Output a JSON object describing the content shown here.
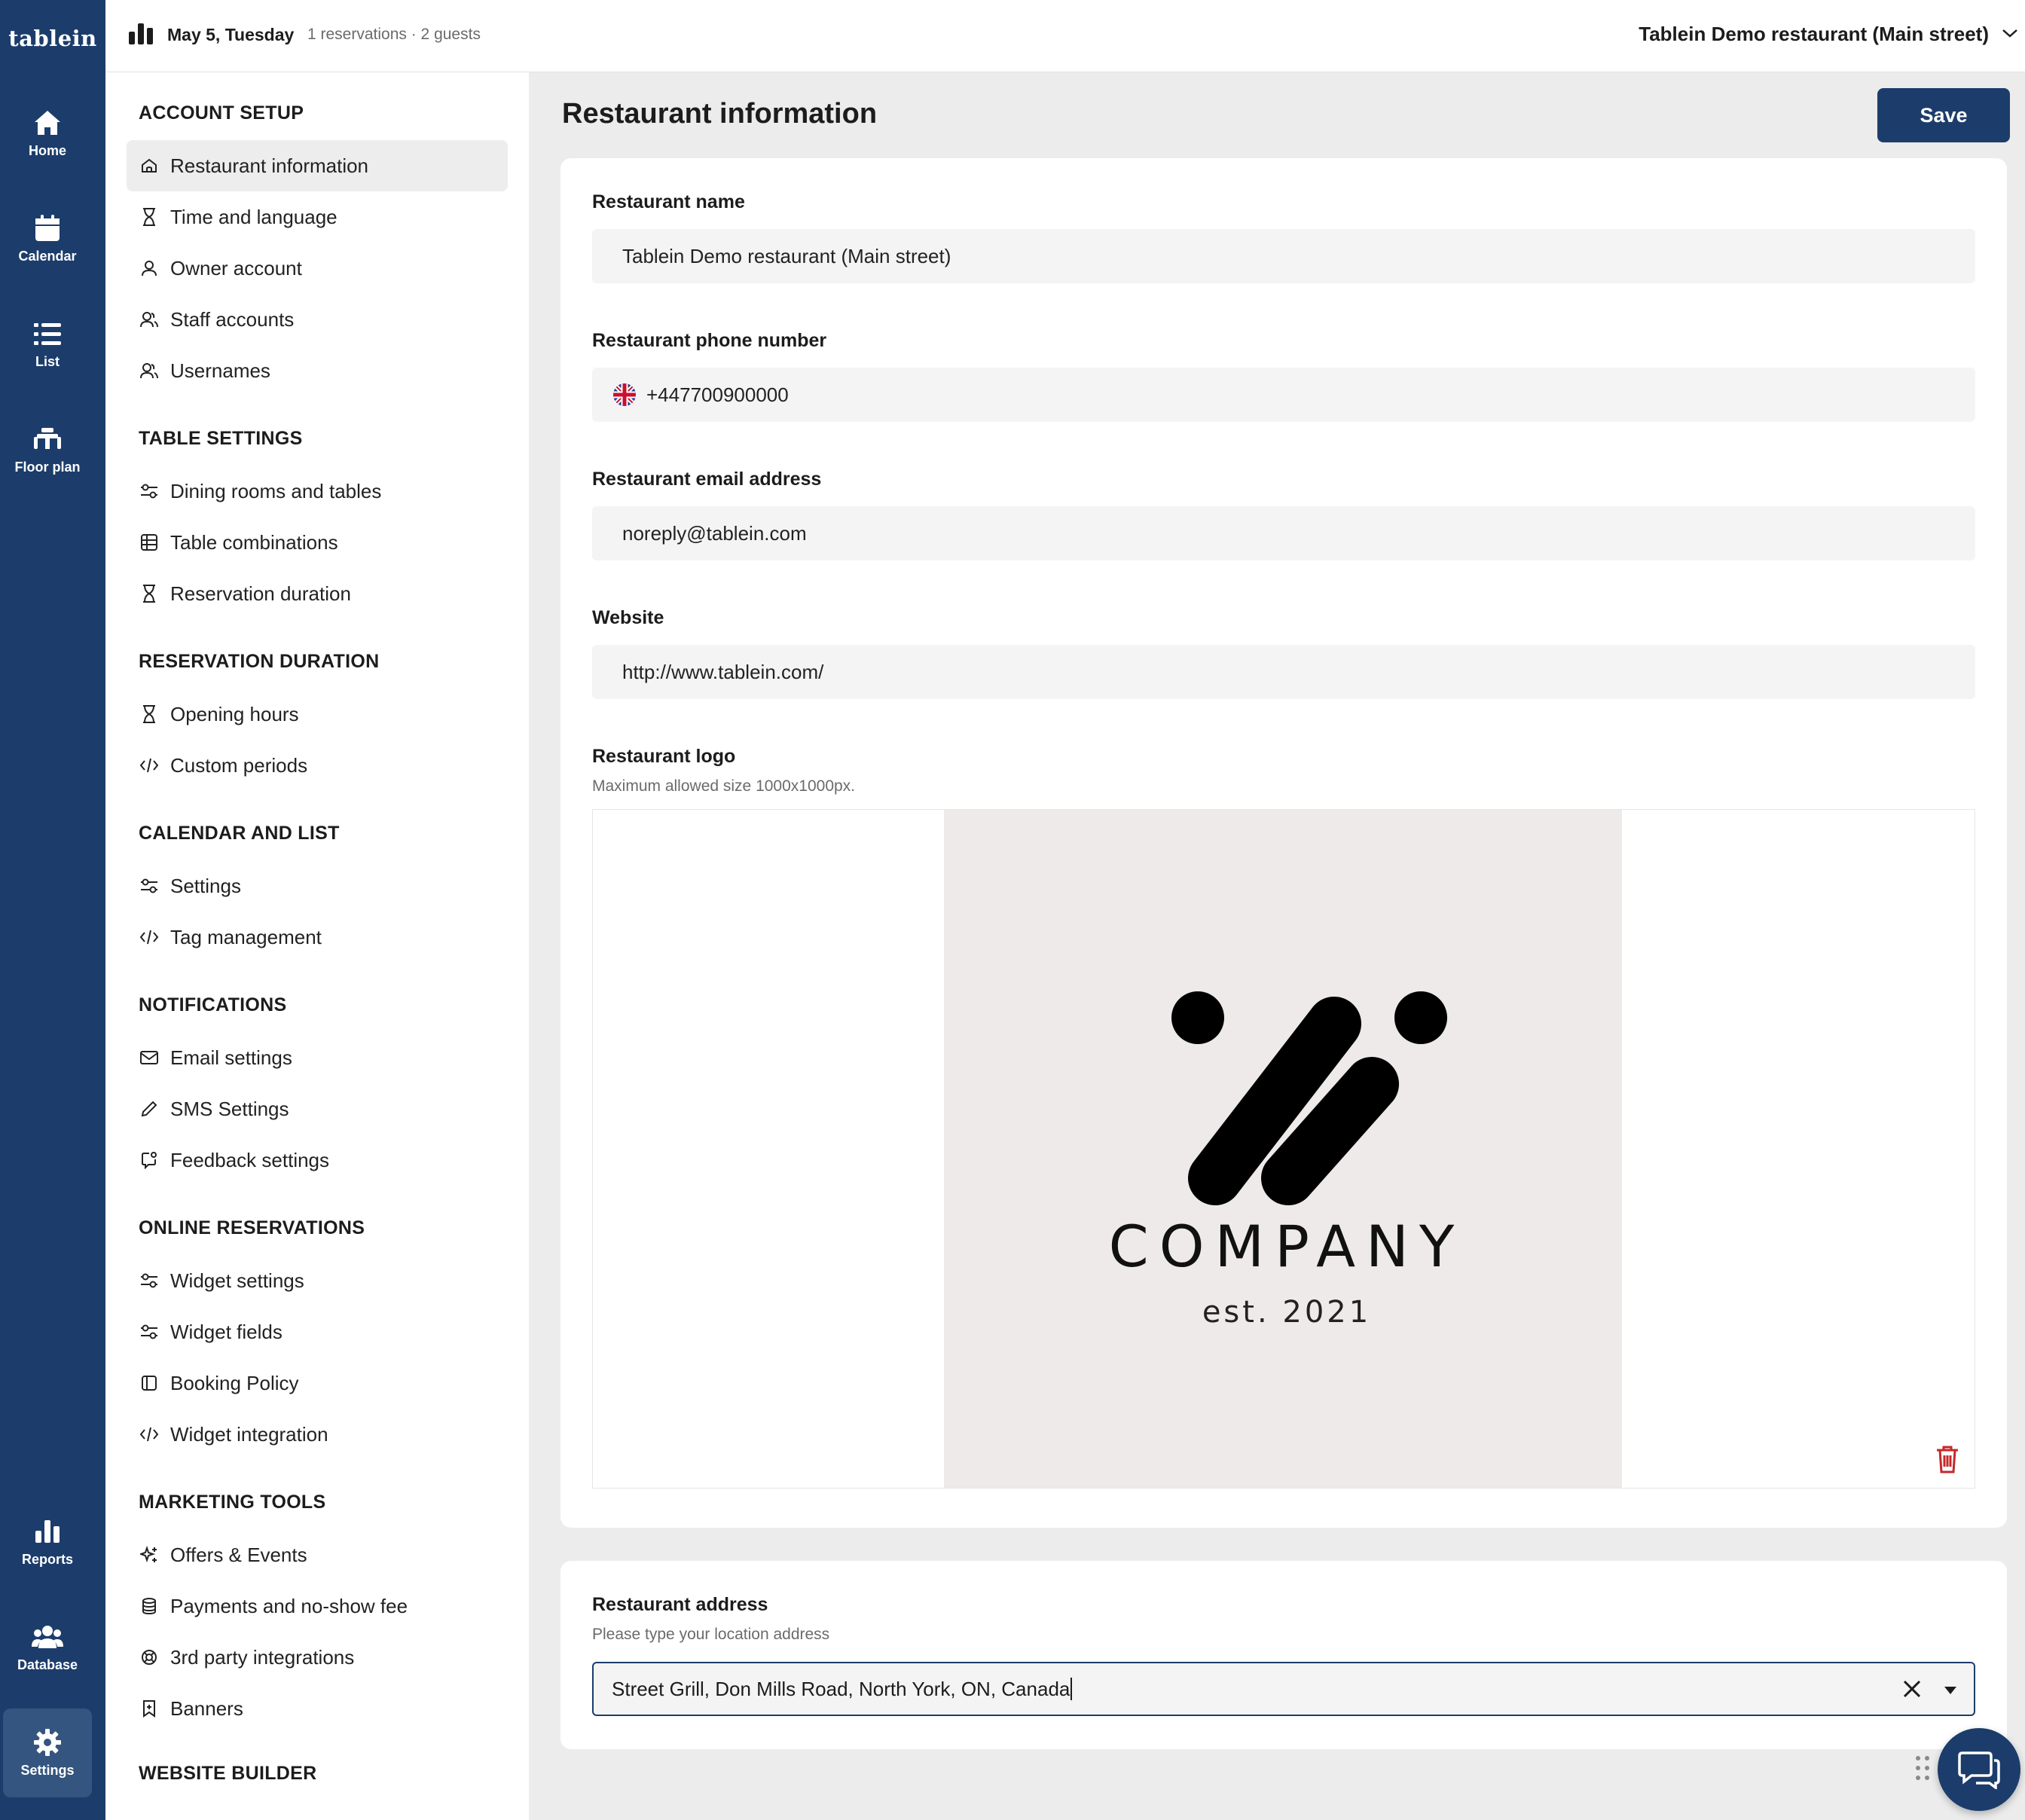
{
  "brand": "tablein",
  "rail": {
    "items": [
      {
        "label": "Home",
        "icon": "home-icon"
      },
      {
        "label": "Calendar",
        "icon": "calendar-icon"
      },
      {
        "label": "List",
        "icon": "list-icon"
      },
      {
        "label": "Floor plan",
        "icon": "floor-plan-icon"
      },
      {
        "label": "Reports",
        "icon": "reports-icon"
      },
      {
        "label": "Database",
        "icon": "database-icon"
      },
      {
        "label": "Settings",
        "icon": "settings-icon",
        "active": true
      }
    ]
  },
  "topbar": {
    "date": "May 5, Tuesday",
    "info": "1 reservations · 2 guests",
    "restaurant": "Tablein Demo restaurant (Main street)"
  },
  "menu": {
    "sections": [
      {
        "title": "ACCOUNT SETUP",
        "items": [
          {
            "label": "Restaurant information",
            "icon": "home-outline-icon",
            "active": true
          },
          {
            "label": "Time and language",
            "icon": "hourglass-icon"
          },
          {
            "label": "Owner account",
            "icon": "user-icon"
          },
          {
            "label": "Staff accounts",
            "icon": "users-icon"
          },
          {
            "label": "Usernames",
            "icon": "users-icon"
          }
        ]
      },
      {
        "title": "TABLE SETTINGS",
        "items": [
          {
            "label": "Dining rooms and tables",
            "icon": "sliders-icon"
          },
          {
            "label": "Table combinations",
            "icon": "table-grid-icon"
          },
          {
            "label": "Reservation duration",
            "icon": "hourglass-icon"
          }
        ]
      },
      {
        "title": "RESERVATION DURATION",
        "items": [
          {
            "label": "Opening hours",
            "icon": "hourglass-icon"
          },
          {
            "label": "Custom periods",
            "icon": "code-icon"
          }
        ]
      },
      {
        "title": "CALENDAR AND LIST",
        "items": [
          {
            "label": "Settings",
            "icon": "sliders-icon"
          },
          {
            "label": "Tag management",
            "icon": "code-icon"
          }
        ]
      },
      {
        "title": "NOTIFICATIONS",
        "items": [
          {
            "label": "Email settings",
            "icon": "mail-icon"
          },
          {
            "label": "SMS Settings",
            "icon": "pencil-icon"
          },
          {
            "label": "Feedback settings",
            "icon": "feedback-icon"
          }
        ]
      },
      {
        "title": "ONLINE RESERVATIONS",
        "items": [
          {
            "label": "Widget settings",
            "icon": "sliders-icon"
          },
          {
            "label": "Widget fields",
            "icon": "sliders-icon"
          },
          {
            "label": "Booking Policy",
            "icon": "sidebar-icon"
          },
          {
            "label": "Widget integration",
            "icon": "code-icon"
          }
        ]
      },
      {
        "title": "MARKETING TOOLS",
        "items": [
          {
            "label": "Offers & Events",
            "icon": "sparkle-icon"
          },
          {
            "label": "Payments and no-show fee",
            "icon": "coins-icon"
          },
          {
            "label": "3rd party integrations",
            "icon": "lifebuoy-icon"
          },
          {
            "label": "Banners",
            "icon": "bookmark-icon"
          }
        ]
      },
      {
        "title": "WEBSITE BUILDER",
        "items": []
      }
    ]
  },
  "main": {
    "title": "Restaurant information",
    "save_label": "Save",
    "fields": {
      "name": {
        "label": "Restaurant name",
        "value": "Tablein Demo restaurant (Main street)"
      },
      "phone": {
        "label": "Restaurant phone number",
        "value": "+447700900000"
      },
      "email": {
        "label": "Restaurant email address",
        "value": "noreply@tablein.com"
      },
      "website": {
        "label": "Website",
        "value": "http://www.tablein.com/"
      }
    },
    "logo": {
      "label": "Restaurant logo",
      "help": "Maximum allowed size 1000x1000px.",
      "company": "COMPANY",
      "est": "est. 2021"
    },
    "address": {
      "label": "Restaurant address",
      "help": "Please type your location address",
      "value": "Street Grill, Don Mills Road, North York, ON, Canada"
    }
  },
  "colors": {
    "brand": "#1c3d6b",
    "delete": "#c62828"
  }
}
